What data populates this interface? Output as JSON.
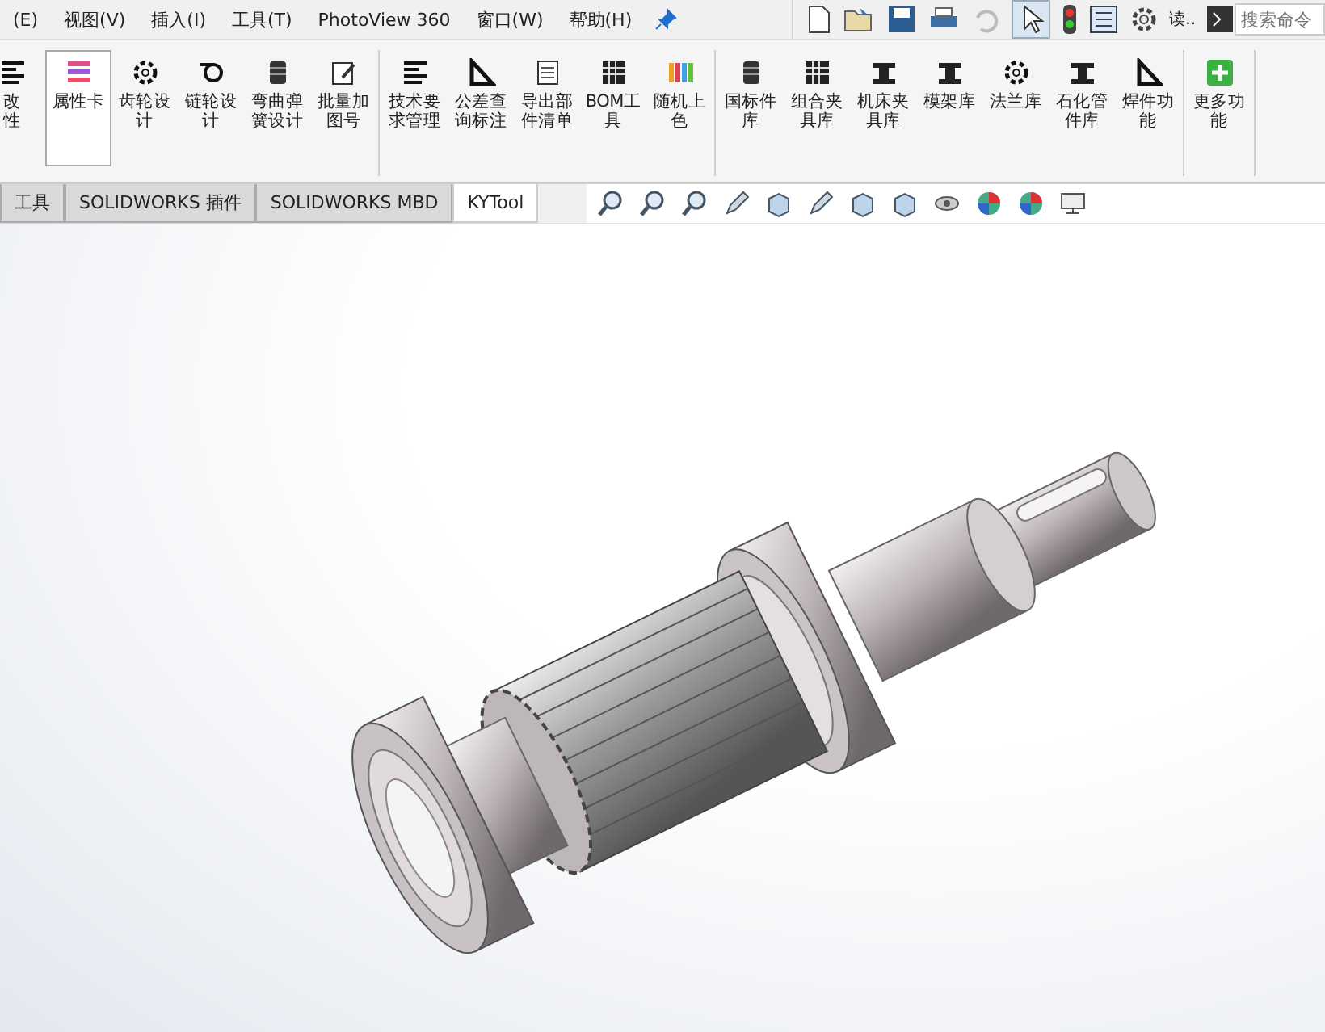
{
  "menu": [
    "(E)",
    "视图(V)",
    "插入(I)",
    "工具(T)",
    "PhotoView 360",
    "窗口(W)",
    "帮助(H)"
  ],
  "quick_label": "读..",
  "search": {
    "placeholder": "搜索命令"
  },
  "ribbon_groups": [
    {
      "buttons": [
        {
          "lines": [
            "改",
            "性"
          ],
          "selected": false,
          "kind": "lines"
        },
        {
          "lines": [
            "属性卡"
          ],
          "selected": true,
          "kind": "colorlist"
        },
        {
          "lines": [
            "齿轮设",
            "计"
          ],
          "selected": false,
          "kind": "gear"
        },
        {
          "lines": [
            "链轮设",
            "计"
          ],
          "selected": false,
          "kind": "chain"
        },
        {
          "lines": [
            "弯曲弹",
            "簧设计"
          ],
          "selected": false,
          "kind": "spring"
        },
        {
          "lines": [
            "批量加",
            "图号"
          ],
          "selected": false,
          "kind": "pencil"
        }
      ]
    },
    {
      "buttons": [
        {
          "lines": [
            "技术要",
            "求管理"
          ],
          "selected": false,
          "kind": "lines"
        },
        {
          "lines": [
            "公差查",
            "询标注"
          ],
          "selected": false,
          "kind": "triangle"
        },
        {
          "lines": [
            "导出部",
            "件清单"
          ],
          "selected": false,
          "kind": "doc"
        },
        {
          "lines": [
            "BOM工",
            "具"
          ],
          "selected": false,
          "kind": "grid"
        },
        {
          "lines": [
            "随机上",
            "色"
          ],
          "selected": false,
          "kind": "bars"
        }
      ]
    },
    {
      "buttons": [
        {
          "lines": [
            "国标件",
            "库"
          ],
          "selected": false,
          "kind": "spring"
        },
        {
          "lines": [
            "组合夹",
            "具库"
          ],
          "selected": false,
          "kind": "grid"
        },
        {
          "lines": [
            "机床夹",
            "具库"
          ],
          "selected": false,
          "kind": "clamp"
        },
        {
          "lines": [
            "模架库"
          ],
          "selected": false,
          "kind": "clamp"
        },
        {
          "lines": [
            "法兰库"
          ],
          "selected": false,
          "kind": "gear"
        },
        {
          "lines": [
            "石化管",
            "件库"
          ],
          "selected": false,
          "kind": "clamp"
        },
        {
          "lines": [
            "焊件功",
            "能"
          ],
          "selected": false,
          "kind": "triangle"
        }
      ]
    },
    {
      "buttons": [
        {
          "lines": [
            "更多功",
            "能"
          ],
          "selected": false,
          "kind": "plus"
        }
      ]
    }
  ],
  "tabs": [
    {
      "label": "工具",
      "selected": false
    },
    {
      "label": "SOLIDWORKS 插件",
      "selected": false
    },
    {
      "label": "SOLIDWORKS MBD",
      "selected": false
    },
    {
      "label": "KYTool",
      "selected": true
    }
  ]
}
